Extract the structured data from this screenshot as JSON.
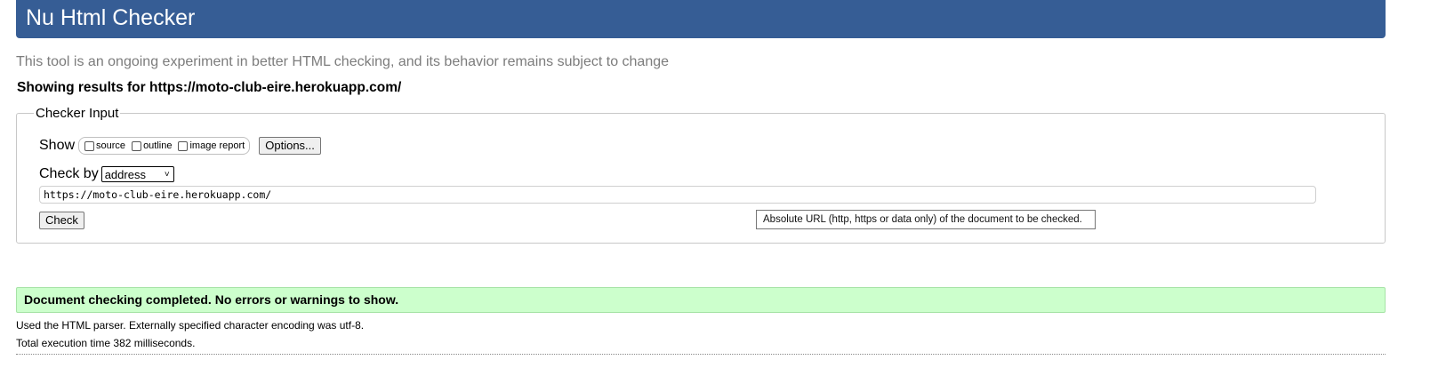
{
  "header": {
    "title": "Nu Html Checker"
  },
  "tagline": "This tool is an ongoing experiment in better HTML checking, and its behavior remains subject to change",
  "results_for": "Showing results for https://moto-club-eire.herokuapp.com/",
  "checker_input": {
    "legend": "Checker Input",
    "show_label": "Show",
    "show_options": [
      {
        "label": "source",
        "checked": false
      },
      {
        "label": "outline",
        "checked": false
      },
      {
        "label": "image report",
        "checked": false
      }
    ],
    "options_button": "Options...",
    "check_by_label": "Check by",
    "check_by_selected": "address",
    "url_value": "https://moto-club-eire.herokuapp.com/",
    "check_button": "Check",
    "tooltip": "Absolute URL (http, https or data only) of the document to be checked."
  },
  "result": {
    "success_message": "Document checking completed. No errors or warnings to show.",
    "parser_info": "Used the HTML parser. Externally specified character encoding was utf-8.",
    "execution_time": "Total execution time 382 milliseconds."
  },
  "colors": {
    "header_bg": "#365d95",
    "success_bg": "#ccffcc",
    "tagline": "#7c7c7c"
  }
}
